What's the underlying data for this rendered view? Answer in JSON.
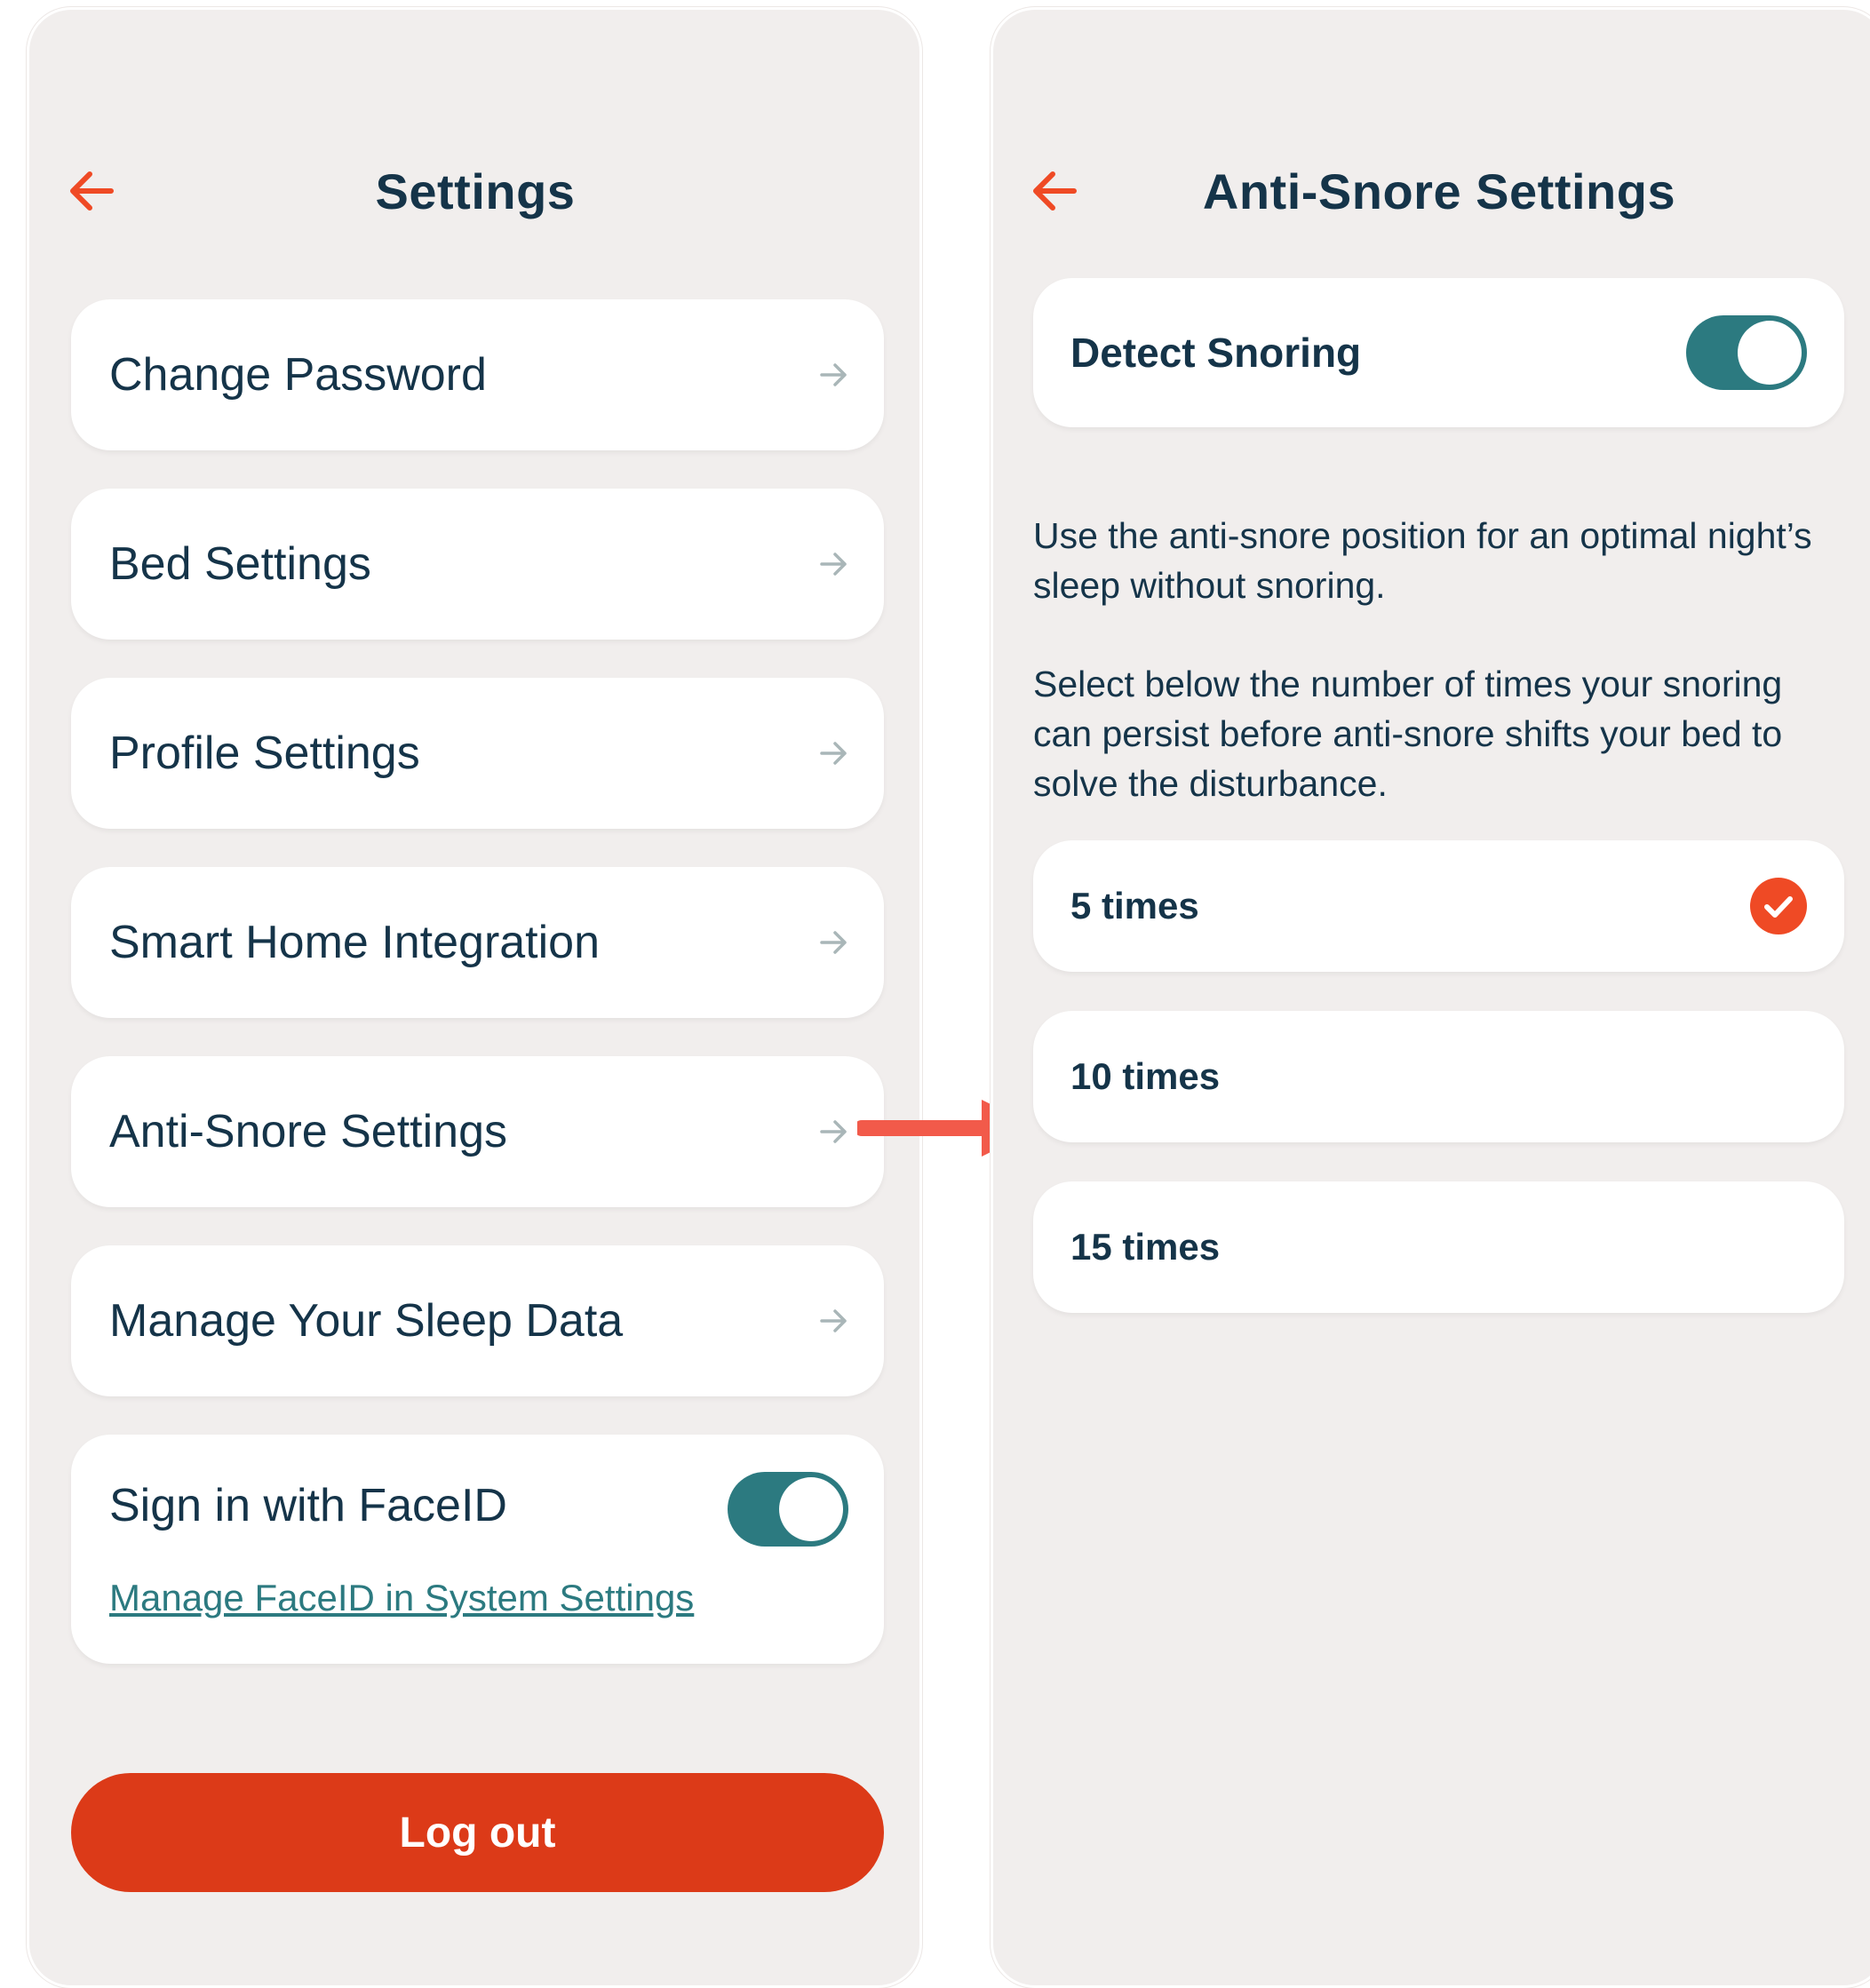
{
  "colors": {
    "accent_orange": "#ef4a25",
    "logout_red": "#dc3a18",
    "toggle_teal": "#2c7a80",
    "text_navy": "#153449",
    "screen_bg": "#f1eeed",
    "flow_arrow": "#f25a4a"
  },
  "settings_screen": {
    "back_icon": "arrow-left-icon",
    "title": "Settings",
    "menu_items": [
      {
        "label": "Change Password",
        "icon": "chevron-arrow-right-icon"
      },
      {
        "label": "Bed Settings",
        "icon": "chevron-arrow-right-icon"
      },
      {
        "label": "Profile Settings",
        "icon": "chevron-arrow-right-icon"
      },
      {
        "label": "Smart Home Integration",
        "icon": "chevron-arrow-right-icon"
      },
      {
        "label": "Anti-Snore Settings",
        "icon": "chevron-arrow-right-icon"
      },
      {
        "label": "Manage Your Sleep Data",
        "icon": "chevron-arrow-right-icon"
      }
    ],
    "faceid": {
      "label": "Sign in with FaceID",
      "enabled": true,
      "link": "Manage FaceID in System Settings"
    },
    "logout_label": "Log out"
  },
  "anti_snore_screen": {
    "back_icon": "arrow-left-icon",
    "title": "Anti-Snore Settings",
    "detect_snoring": {
      "label": "Detect Snoring",
      "enabled": true
    },
    "description_1": "Use the anti-snore position for an optimal night’s sleep without snoring.",
    "description_2": "Select below the number of times your snoring can persist before anti-snore shifts your bed to solve the disturbance.",
    "options": [
      {
        "label": "5 times",
        "selected": true
      },
      {
        "label": "10 times",
        "selected": false
      },
      {
        "label": "15 times",
        "selected": false
      }
    ]
  },
  "flow_arrow_icon": "flow-arrow-right-icon"
}
